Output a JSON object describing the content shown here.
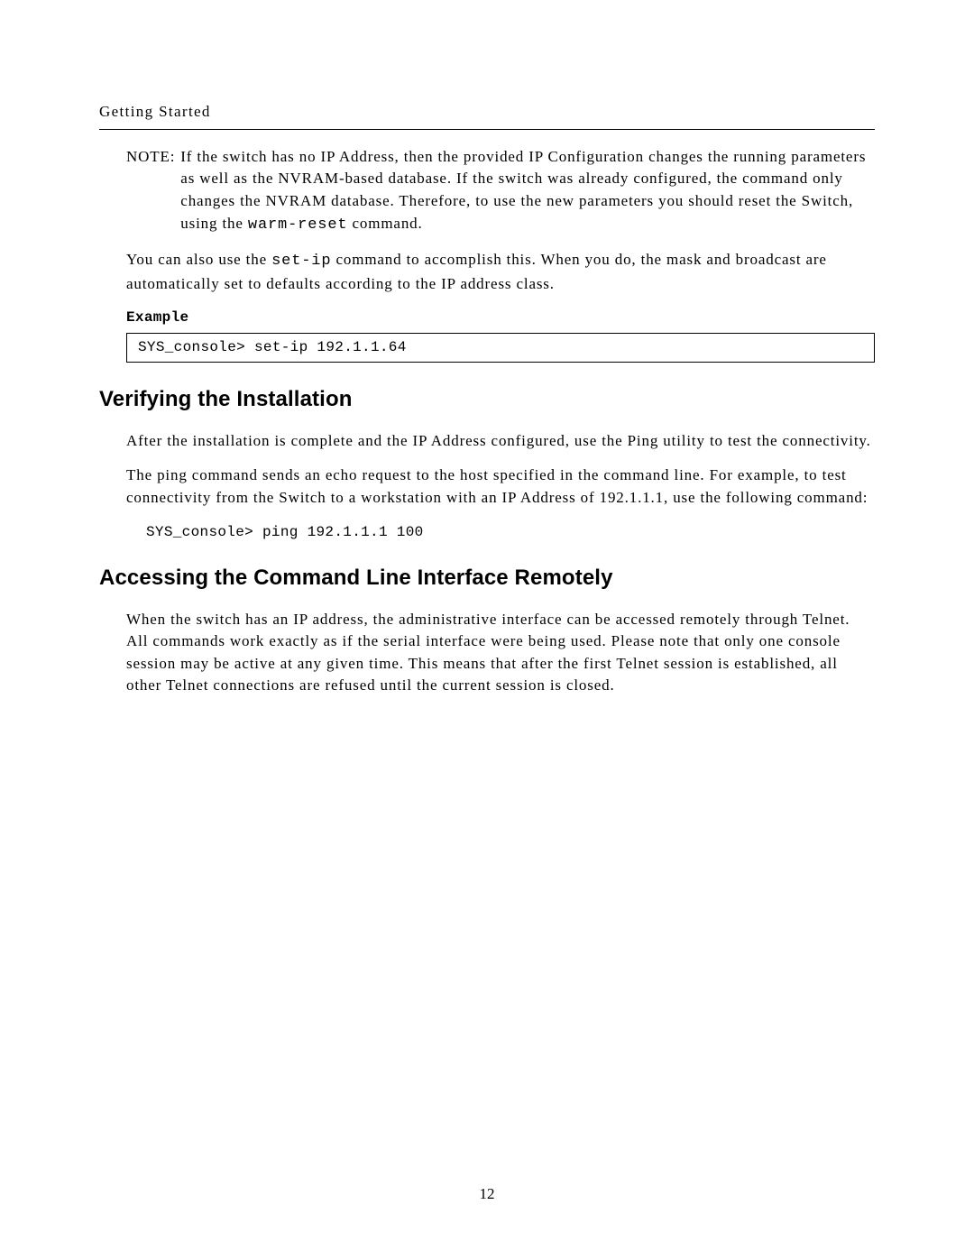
{
  "header": {
    "running_head": "Getting Started"
  },
  "note": {
    "label": "NOTE:",
    "body_pre": "If the switch has no IP Address, then the provided IP Configuration changes the running parameters as well as the NVRAM-based database.  If the switch was already configured, the command only changes the NVRAM database.  Therefore, to use the new parameters you should reset the Switch, using the ",
    "body_code": "warm-reset",
    "body_post": " command."
  },
  "para_setip": {
    "pre": "You can also use the ",
    "code": "set-ip",
    "post": " command to accomplish this.  When you do, the mask and broadcast are automatically set to defaults according to the IP address class."
  },
  "example": {
    "label": "Example",
    "code": "SYS_console> set-ip 192.1.1.64"
  },
  "sections": {
    "verify": {
      "heading": "Verifying the Installation",
      "p1": "After the installation is complete and the IP Address configured, use the Ping utility to test the connectivity.",
      "p2": "The ping command sends an echo request to the host specified in the command line.  For example, to test connectivity from the Switch to a workstation with an IP Address of 192.1.1.1, use the following command:",
      "code": "SYS_console> ping 192.1.1.1 100"
    },
    "remote": {
      "heading": "Accessing the Command Line Interface Remotely",
      "p1": "When the switch has an IP address, the administrative interface can be accessed remotely through Telnet.  All commands work exactly as if the serial interface were being used.  Please note that only one console session may be active at any given time.  This means that after the first Telnet session is established, all other Telnet connections are refused until the current session is closed."
    }
  },
  "footer": {
    "page_number": "12"
  }
}
